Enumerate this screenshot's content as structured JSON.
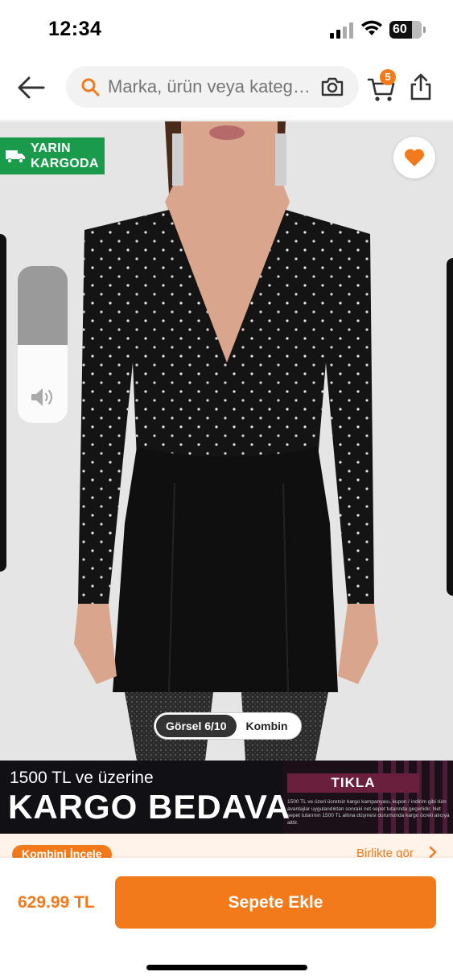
{
  "status_bar": {
    "time": "12:34",
    "battery": "60"
  },
  "header": {
    "search_placeholder": "Marka, ürün veya kategori ara",
    "cart_count": "5",
    "icons": [
      "back-arrow-icon",
      "search-icon",
      "camera-icon",
      "cart-icon",
      "share-icon"
    ]
  },
  "gallery": {
    "delivery_badge": {
      "line1": "YARIN",
      "line2": "KARGODA"
    },
    "pager": {
      "current": "Görsel 6/10",
      "kombin": "Kombin"
    },
    "volume_level": 0.5
  },
  "promo": {
    "line1": "1500 TL ve üzerine",
    "line2": "KARGO BEDAVA",
    "cta": "TIKLA",
    "fine_print": "1500 TL ve üzeri ücretsiz kargo kampanyası, kupon / indirim gibi tüm avantajlar uygulandıktan sonraki net sepet tutarında geçerlidir. Net sepet tutarının 1500 TL altına düşmesi durumunda kargo ücreti alıcıya aittir."
  },
  "combo_strip": {
    "button": "Kombini İncele",
    "link": "Birlikte gör"
  },
  "bottom_bar": {
    "price": "629.99 TL",
    "add_to_cart": "Sepete Ekle"
  },
  "colors": {
    "brand_orange": "#f27a1a",
    "delivery_green": "#1a9b4c",
    "promo_cta": "#6a1f3c"
  }
}
